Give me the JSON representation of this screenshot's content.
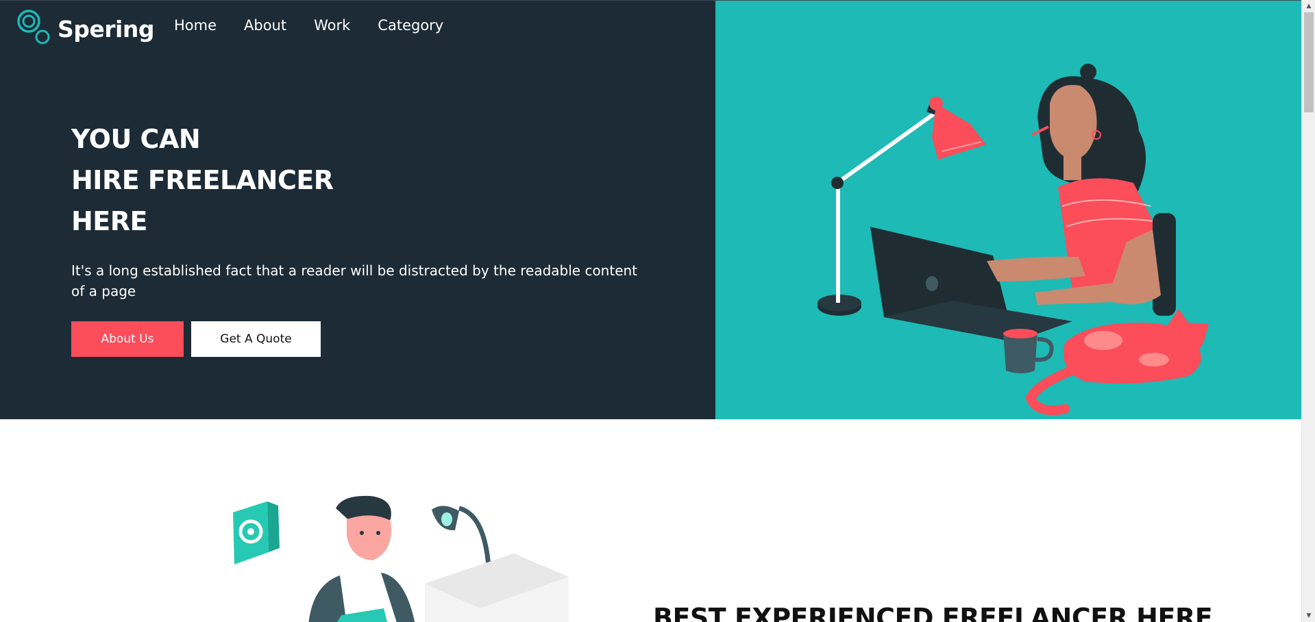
{
  "brand": {
    "name": "Spering",
    "accent": "#1dbab6"
  },
  "nav": {
    "items": [
      "Home",
      "About",
      "Work",
      "Category"
    ]
  },
  "hero": {
    "headline": [
      "YOU CAN",
      "HIRE FREELANCER",
      "HERE"
    ],
    "description": "It's a long established fact that a reader will be distracted by the readable content of a page",
    "primary_button": "About Us",
    "secondary_button": "Get A Quote",
    "colors": {
      "dark": "#1d2b36",
      "teal": "#1dbab6",
      "coral": "#fb4d5a"
    }
  },
  "section2": {
    "title": "BEST EXPERIENCED FREELANCER HERE"
  },
  "icons": [
    "logo-rings-icon",
    "gear-icon",
    "scroll-up-arrow-icon",
    "scroll-down-arrow-icon"
  ]
}
